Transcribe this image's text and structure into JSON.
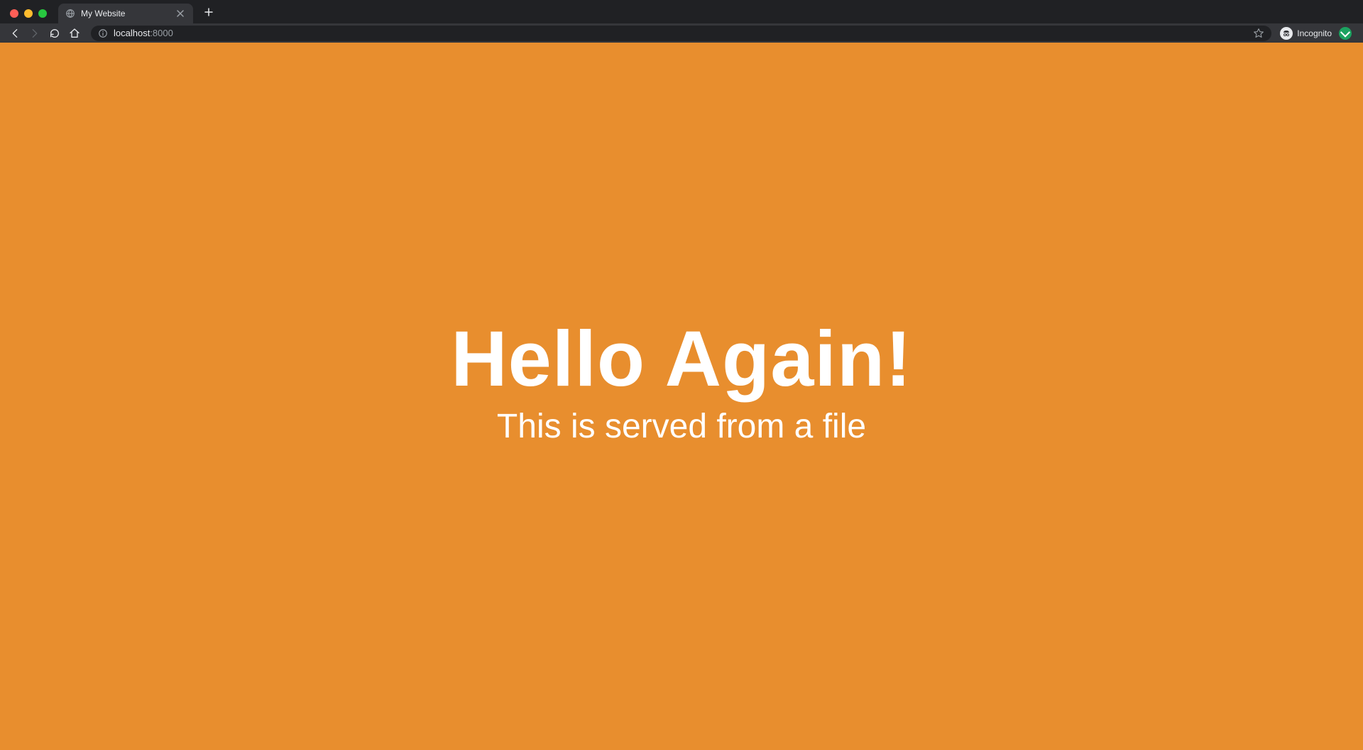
{
  "browser": {
    "tab": {
      "title": "My Website"
    },
    "url": {
      "host": "localhost",
      "port": ":8000"
    },
    "incognito_label": "Incognito"
  },
  "page": {
    "heading": "Hello Again!",
    "subheading": "This is served from a file",
    "bg_color": "#e88e2e",
    "text_color": "#ffffff"
  }
}
